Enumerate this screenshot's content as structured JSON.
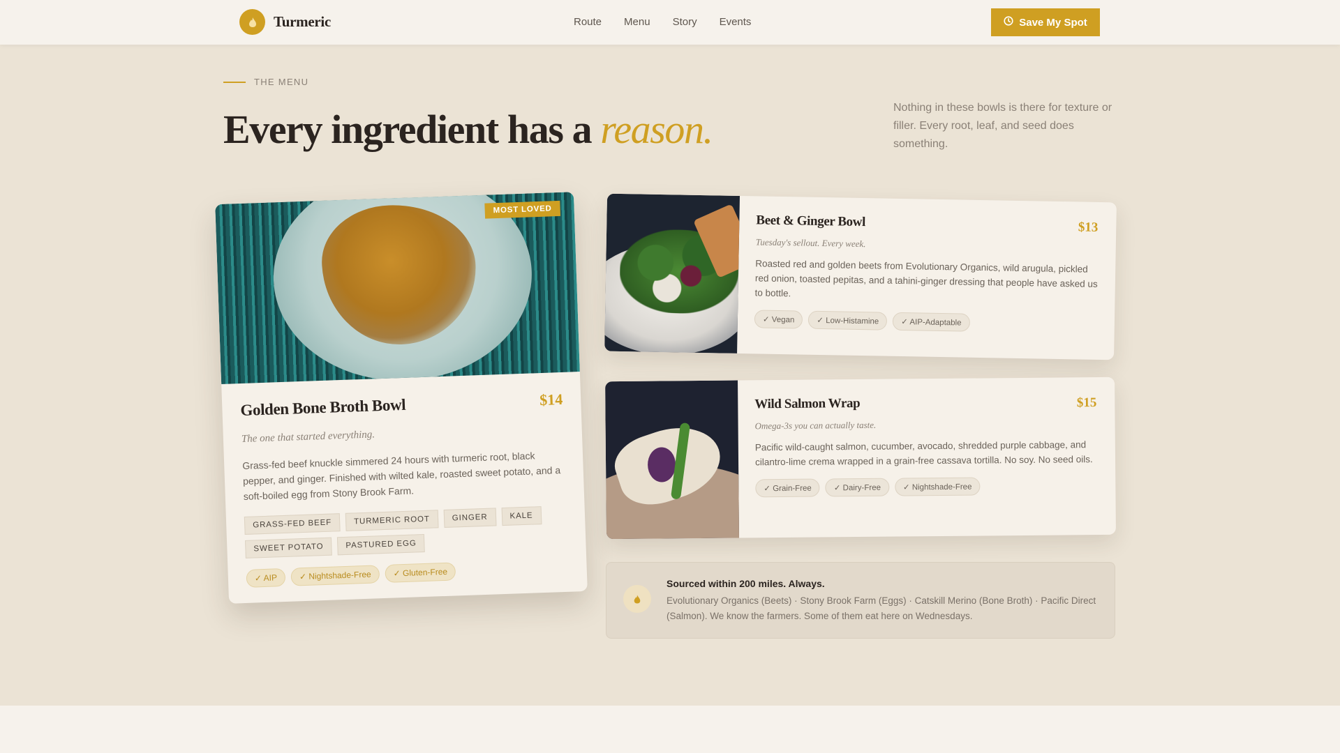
{
  "nav": {
    "brand": "Turmeric",
    "links": [
      "Route",
      "Menu",
      "Story",
      "Events"
    ],
    "cta_label": "Save My Spot"
  },
  "hero": {
    "eyebrow": "THE MENU",
    "title_main": "Every ingredient has a ",
    "title_accent": "reason.",
    "description": "Nothing in these bowls is there for texture or filler. Every root, leaf, and seed does something."
  },
  "featured": {
    "badge": "MOST LOVED",
    "title": "Golden Bone Broth Bowl",
    "price": "$14",
    "subtitle": "The one that started everything.",
    "description": "Grass-fed beef knuckle simmered 24 hours with turmeric root, black pepper, and ginger. Finished with wilted kale, roasted sweet potato, and a soft-boiled egg from Stony Brook Farm.",
    "ingredients": [
      "GRASS-FED BEEF",
      "TURMERIC ROOT",
      "GINGER",
      "KALE",
      "SWEET POTATO",
      "PASTURED EGG"
    ],
    "tags": [
      "✓ AIP",
      "✓ Nightshade-Free",
      "✓ Gluten-Free"
    ]
  },
  "beet": {
    "title": "Beet & Ginger Bowl",
    "price": "$13",
    "subtitle": "Tuesday's sellout. Every week.",
    "description": "Roasted red and golden beets from Evolutionary Organics, wild arugula, pickled red onion, toasted pepitas, and a tahini-ginger dressing that people have asked us to bottle.",
    "tags": [
      "✓ Vegan",
      "✓ Low-Histamine",
      "✓ AIP-Adaptable"
    ]
  },
  "wrap": {
    "title": "Wild Salmon Wrap",
    "price": "$15",
    "subtitle": "Omega-3s you can actually taste.",
    "description": "Pacific wild-caught salmon, cucumber, avocado, shredded purple cabbage, and cilantro-lime crema wrapped in a grain-free cassava tortilla. No soy. No seed oils.",
    "tags": [
      "✓ Grain-Free",
      "✓ Dairy-Free",
      "✓ Nightshade-Free"
    ]
  },
  "sourced": {
    "title": "Sourced within 200 miles. Always.",
    "body": "Evolutionary Organics (Beets) · Stony Brook Farm (Eggs) · Catskill Merino (Bone Broth) · Pacific Direct (Salmon). We know the farmers. Some of them eat here on Wednesdays."
  },
  "colors": {
    "accent": "#cf9f22",
    "background": "#ebe3d5",
    "card": "#f6f1e9",
    "text": "#2b2420"
  },
  "icons": {
    "brand": "flame-icon",
    "cta": "clock-icon",
    "sourced": "flame-icon"
  }
}
